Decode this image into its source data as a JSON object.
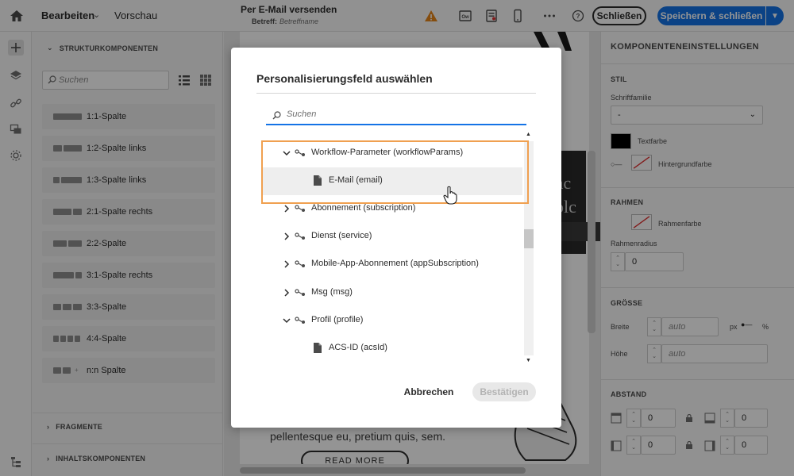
{
  "topbar": {
    "tab_edit": "Bearbeiten",
    "tab_preview": "Vorschau",
    "doc_title": "Per E-Mail versenden",
    "doc_subject_label": "Betreff:",
    "doc_subject_value": "Betreffname",
    "close_label": "Schließen",
    "save_label": "Speichern & schließen",
    "icons": [
      "home-icon",
      "warning-icon",
      "ow-icon",
      "checklist-icon",
      "mobile-icon",
      "more-icon",
      "help-icon"
    ]
  },
  "left_panel": {
    "structure_header": "STRUKTURKOMPONENTEN",
    "search_placeholder": "Suchen",
    "components": [
      {
        "label": "1:1-Spalte"
      },
      {
        "label": "1:2-Spalte links"
      },
      {
        "label": "1:3-Spalte links"
      },
      {
        "label": "2:1-Spalte rechts"
      },
      {
        "label": "2:2-Spalte"
      },
      {
        "label": "3:1-Spalte rechts"
      },
      {
        "label": "3:3-Spalte"
      },
      {
        "label": "4:4-Spalte"
      },
      {
        "label": "n:n Spalte"
      }
    ],
    "fragments_header": "FRAGMENTE",
    "content_header": "INHALTSKOMPONENTEN"
  },
  "canvas": {
    "hero_line1": "er ac",
    "hero_line2": "dolc",
    "lorem": "pellentesque eu, pretium quis, sem.",
    "read_more": "READ MORE"
  },
  "right_panel": {
    "title": "KOMPONENTENEINSTELLUNGEN",
    "style_header": "STIL",
    "font_family_label": "Schriftfamilie",
    "font_family_value": "-",
    "text_color_label": "Textfarbe",
    "bg_color_label": "Hintergrundfarbe",
    "border_header": "RAHMEN",
    "border_color_label": "Rahmenfarbe",
    "border_radius_label": "Rahmenradius",
    "border_radius_value": "0",
    "size_header": "GRÖSSE",
    "width_label": "Breite",
    "width_placeholder": "auto",
    "unit_px": "px",
    "unit_pct": "%",
    "height_label": "Höhe",
    "height_placeholder": "auto",
    "spacing_header": "ABSTAND",
    "spacing_values": [
      "0",
      "0",
      "0",
      "0"
    ],
    "colors": {
      "text": "#000000",
      "accent": "#e03030"
    }
  },
  "modal": {
    "title": "Personalisierungsfeld auswählen",
    "search_placeholder": "Suchen",
    "tree": [
      {
        "label": "Workflow-Parameter (workflowParams)",
        "type": "node",
        "expanded": true
      },
      {
        "label": "E-Mail (email)",
        "type": "leaf",
        "selected": true
      },
      {
        "label": "Abonnement (subscription)",
        "type": "node",
        "expanded": false
      },
      {
        "label": "Dienst (service)",
        "type": "node",
        "expanded": false
      },
      {
        "label": "Mobile-App-Abonnement (appSubscription)",
        "type": "node",
        "expanded": false
      },
      {
        "label": "Msg (msg)",
        "type": "node",
        "expanded": false
      },
      {
        "label": "Profil (profile)",
        "type": "node",
        "expanded": true
      },
      {
        "label": "ACS-ID (acsId)",
        "type": "leaf",
        "selected": false
      }
    ],
    "cancel_label": "Abbrechen",
    "confirm_label": "Bestätigen",
    "highlight_color": "#f0a050",
    "accent_color": "#1473e6"
  }
}
